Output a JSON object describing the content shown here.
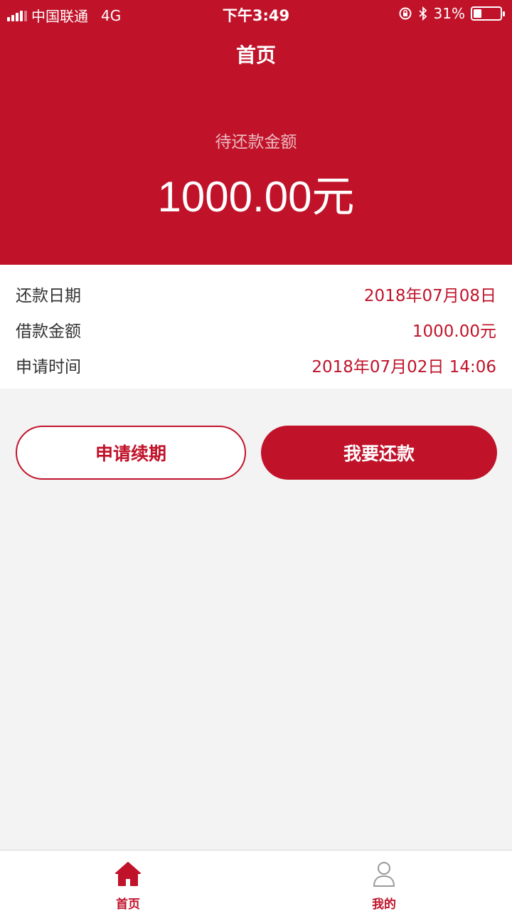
{
  "status_bar": {
    "carrier": "中国联通",
    "network": "4G",
    "time": "下午3:49",
    "battery": "31%",
    "battery_level": 0.31
  },
  "nav": {
    "title": "首页"
  },
  "summary": {
    "label": "待还款金额",
    "amount": "1000.00元"
  },
  "info": {
    "rows": [
      {
        "label": "还款日期",
        "value": "2018年07月08日"
      },
      {
        "label": "借款金额",
        "value": "1000.00元"
      },
      {
        "label": "申请时间",
        "value": "2018年07月02日 14:06"
      }
    ]
  },
  "actions": {
    "renew_label": "申请续期",
    "repay_label": "我要还款"
  },
  "tabbar": {
    "items": [
      {
        "label": "首页",
        "icon": "home-icon",
        "active": true
      },
      {
        "label": "我的",
        "icon": "user-icon",
        "active": false
      }
    ]
  },
  "colors": {
    "primary": "#c0132a",
    "inactive": "#999999"
  }
}
